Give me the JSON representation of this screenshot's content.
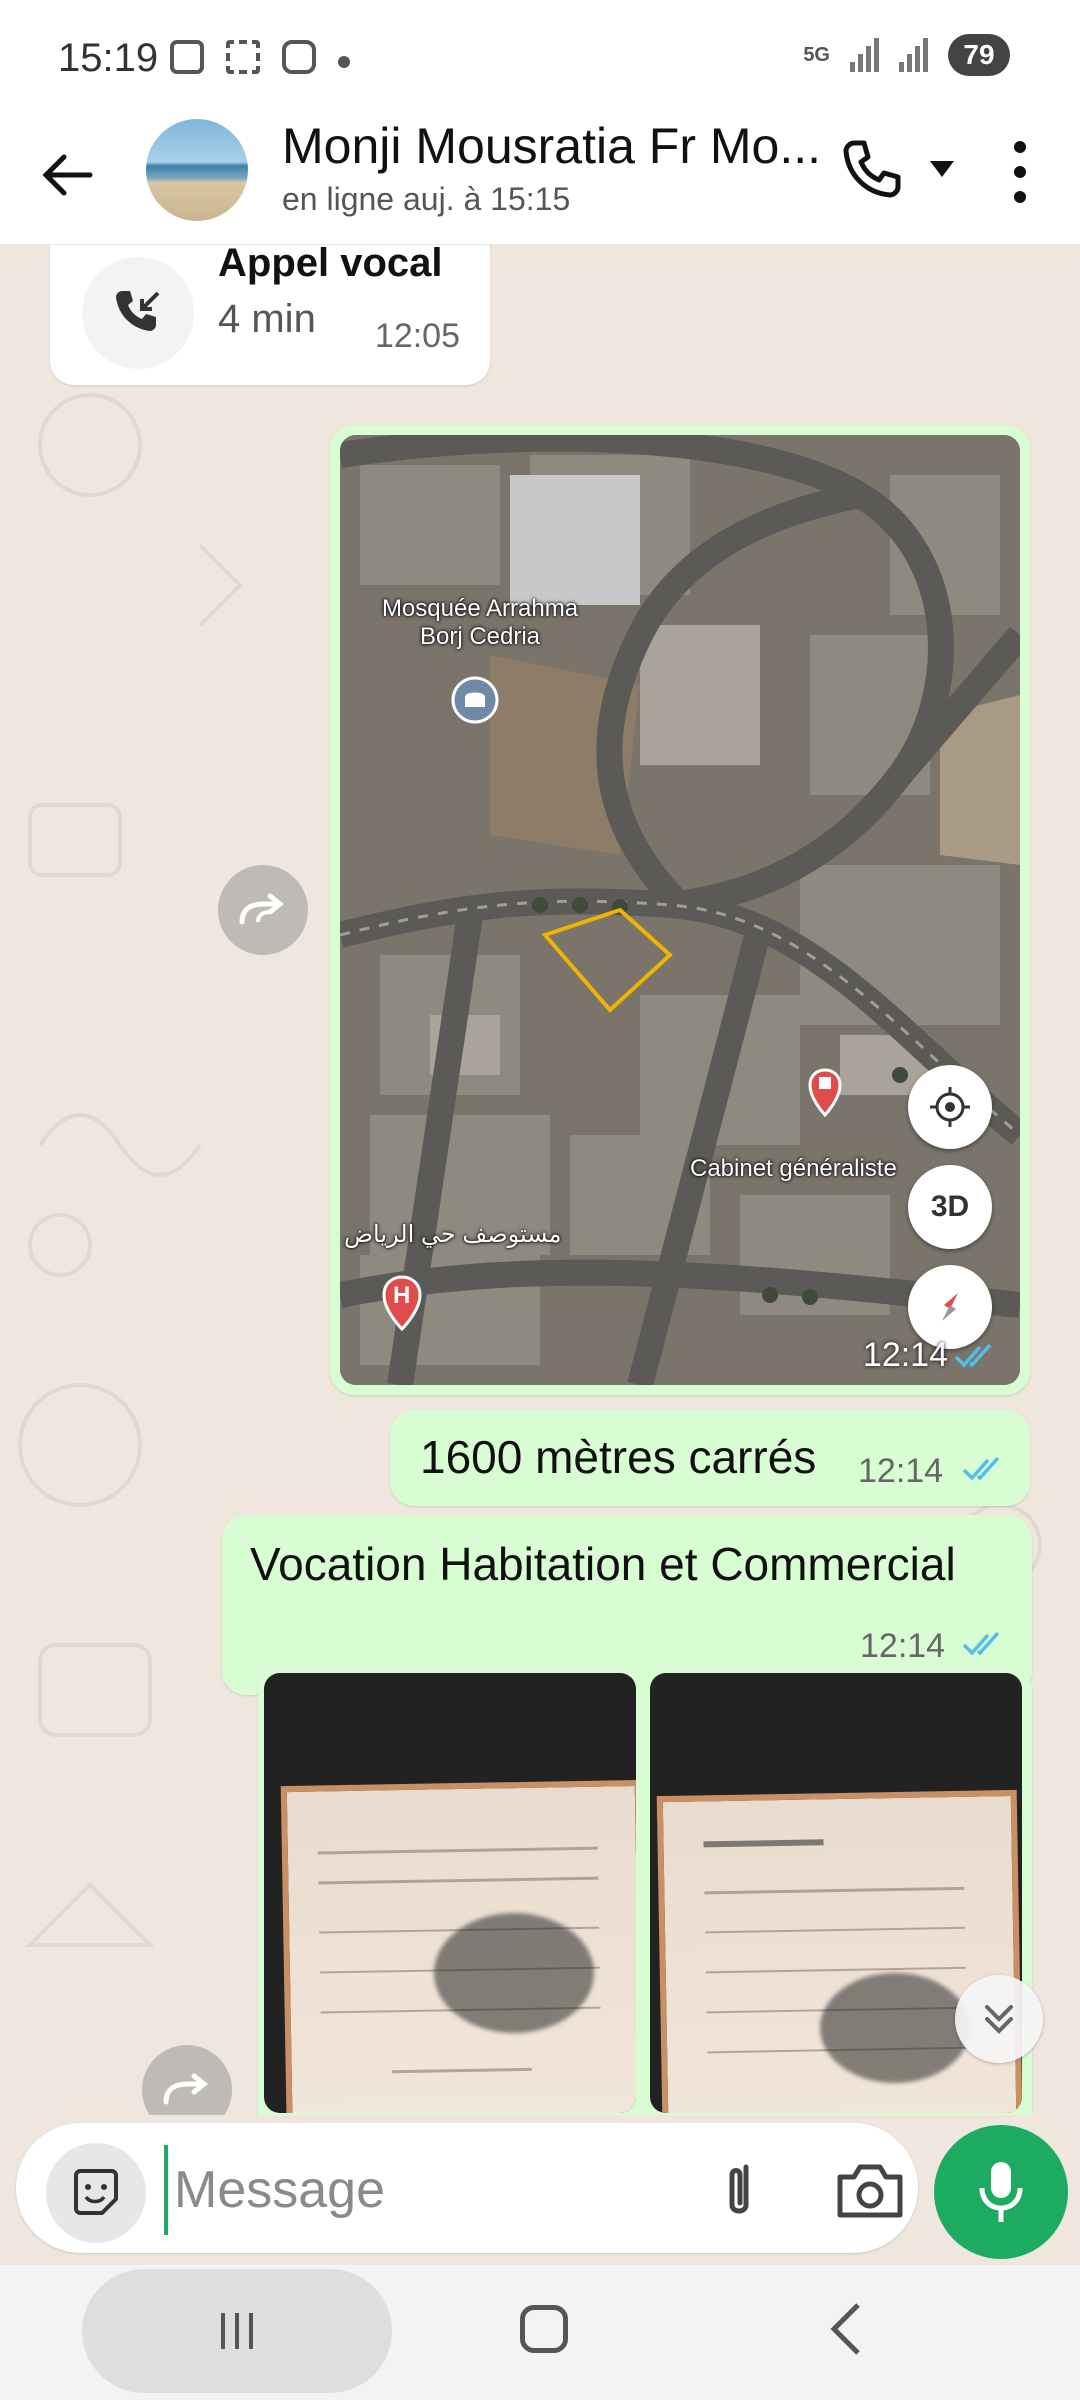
{
  "status_bar": {
    "time": "15:19",
    "network": "5G",
    "battery": "79"
  },
  "header": {
    "contact_name": "Monji Mousratia Fr Mo...",
    "status": "en ligne auj. à 15:15"
  },
  "messages": {
    "call": {
      "title": "Appel vocal",
      "duration": "4 min",
      "time": "12:05"
    },
    "map": {
      "labels": {
        "mosque": "Mosquée Arrahma Borj Cedria",
        "cabinet": "Cabinet généraliste",
        "hospital": "مستوصف حي الرياض"
      },
      "btn_3d": "3D",
      "time": "12:14"
    },
    "text1": {
      "text": "1600 mètres carrés",
      "time": "12:14"
    },
    "text2": {
      "text": "Vocation Habitation et Commercial",
      "time": "12:14"
    }
  },
  "input": {
    "placeholder": "Message"
  },
  "colors": {
    "outgoing_bubble": "#d9fdd3",
    "chat_background": "#efe7de",
    "accent_green": "#1daa61",
    "read_ticks": "#53bdeb"
  }
}
